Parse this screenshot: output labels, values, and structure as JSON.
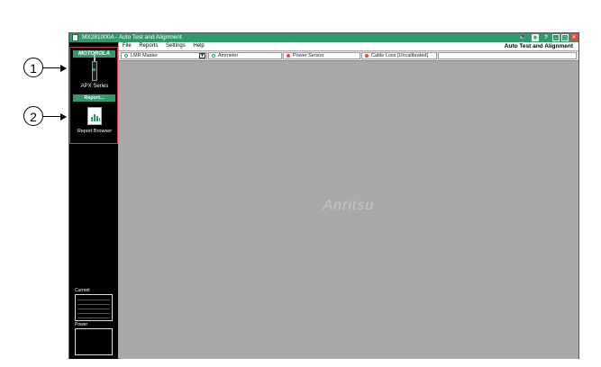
{
  "window": {
    "title": "MX281000A - Auto Test and Alignment",
    "mode_label": "Auto Test and Alignment"
  },
  "titlebar_icons": [
    "speaker-mute-icon",
    "camera-icon",
    "help-icon",
    "minimize-icon",
    "maximize-icon",
    "close-icon"
  ],
  "titlebar": {
    "help_label": "?"
  },
  "menu": {
    "items": [
      "File",
      "Reports",
      "Settings",
      "Help"
    ]
  },
  "status": {
    "lmr_master": "LMR Master",
    "ammeter": "Ammeter",
    "power_sensor": "Power Sensor",
    "cable_loss": "Cable Loss [Uncalibrated]"
  },
  "sidebar": {
    "brand": "MOTOROLA",
    "radio_label": "APX Series",
    "report_button": "Report...",
    "report_browser": "Report Browser",
    "current_label": "Current",
    "power_label": "Power"
  },
  "main": {
    "watermark": "Anritsu"
  },
  "callouts": [
    "1",
    "2"
  ],
  "colors": {
    "accent": "#2e9a6e",
    "highlight": "#d6394a",
    "status_red": "#e04b3c",
    "background": "#a9a9a9"
  }
}
